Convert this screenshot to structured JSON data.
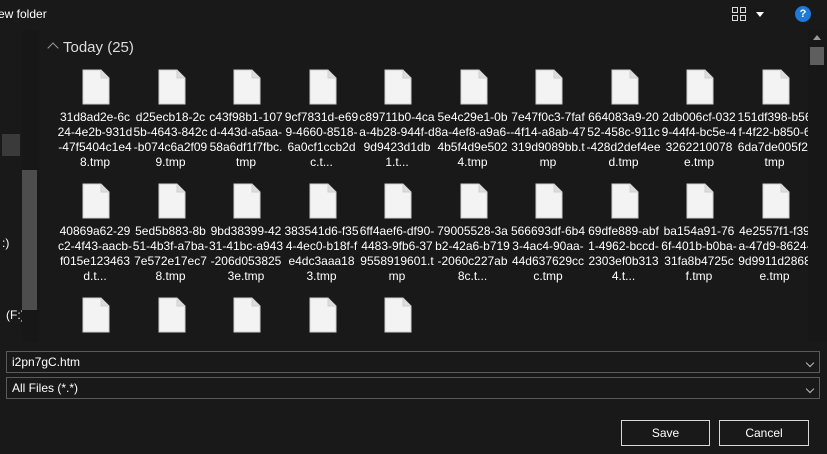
{
  "header": {
    "title": "ew folder",
    "view_icon": "view-options-icon",
    "view_chevron_icon": "chevron-down-icon",
    "help_label": "?"
  },
  "nav": {
    "label_a": ":)",
    "label_b": "(F:)"
  },
  "group": {
    "label": "Today (25)",
    "chevron_icon": "chevron-up-icon"
  },
  "files": [
    {
      "name": "31d8ad2e-6c24-4e2b-931d-47f5404c1e48.tmp"
    },
    {
      "name": "d25ecb18-2c5b-4643-842c-b074c6a2f099.tmp"
    },
    {
      "name": "c43f98b1-107d-443d-a5aa-58a6df1f7fbc.tmp"
    },
    {
      "name": "9cf7831d-e699-4660-8518-6a0cf1ccb2dc.t..."
    },
    {
      "name": "c89711b0-4caa-4b28-944f-d9d9423d1db1.t..."
    },
    {
      "name": "5e4c29e1-0b8a-4ef8-a9a6-4b5f4d9e5024.tmp"
    },
    {
      "name": "7e47f0c3-7faf-4f14-a8ab-47319d9089bb.tmp"
    },
    {
      "name": "664083a9-2052-458c-911c-428d2def4eed.tmp"
    },
    {
      "name": "2db006cf-0329-44f4-bc5e-43262210078e.tmp"
    },
    {
      "name": "151df398-b56f-4f22-b850-66da7de005f2.tmp"
    },
    {
      "name": "40869a62-29c2-4f43-aacb-f015e123463d.t..."
    },
    {
      "name": "5ed5b883-8b51-4b3f-a7ba-7e572e17ec78.tmp"
    },
    {
      "name": "9bd38399-4231-41bc-a943-206d0538253e.tmp"
    },
    {
      "name": "383541d6-f354-4ec0-b18f-fe4dc3aaa183.tmp"
    },
    {
      "name": "6ff4aef6-df90-4483-9fb6-379558919601.tmp"
    },
    {
      "name": "79005528-3ab2-42a6-b719-2060c227ab8c.t..."
    },
    {
      "name": "566693df-6b43-4ac4-90aa-44d637629ccc.tmp"
    },
    {
      "name": "69dfe889-abf1-4962-bccd-2303ef0b3134.t..."
    },
    {
      "name": "ba154a91-766f-401b-b0ba-31fa8b4725cf.tmp"
    },
    {
      "name": "4e2557f1-f39a-47d9-8624-9d9911d2868e.tmp"
    },
    {
      "name": ""
    },
    {
      "name": ""
    },
    {
      "name": ""
    },
    {
      "name": ""
    },
    {
      "name": ""
    }
  ],
  "filename_field": {
    "value": "i2pn7gC.htm",
    "chevron_icon": "chevron-down-icon"
  },
  "filetype_field": {
    "value": "All Files (*.*)",
    "chevron_icon": "chevron-down-icon"
  },
  "buttons": {
    "save_label": "Save",
    "cancel_label": "Cancel"
  },
  "colors": {
    "background": "#191919",
    "accent": "#1d7ad8",
    "border": "#5a5a5a"
  }
}
